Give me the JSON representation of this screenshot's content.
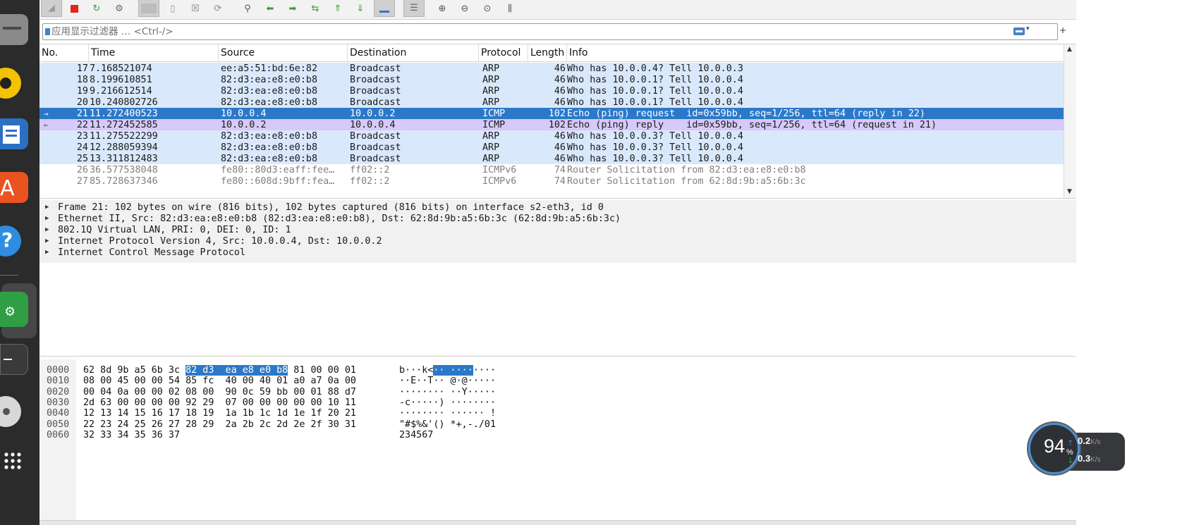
{
  "filter": {
    "placeholder": "应用显示过滤器 … <Ctrl-/>"
  },
  "packet_list": {
    "columns": [
      "No.",
      "Time",
      "Source",
      "Destination",
      "Protocol",
      "Length",
      "Info"
    ],
    "rows": [
      {
        "no": "17",
        "time": "7.168521074",
        "src": "ee:a5:51:bd:6e:82",
        "dst": "Broadcast",
        "proto": "ARP",
        "len": "46",
        "info": "Who has 10.0.0.4? Tell 10.0.0.3",
        "style": "arp"
      },
      {
        "no": "18",
        "time": "8.199610851",
        "src": "82:d3:ea:e8:e0:b8",
        "dst": "Broadcast",
        "proto": "ARP",
        "len": "46",
        "info": "Who has 10.0.0.1? Tell 10.0.0.4",
        "style": "arp"
      },
      {
        "no": "19",
        "time": "9.216612514",
        "src": "82:d3:ea:e8:e0:b8",
        "dst": "Broadcast",
        "proto": "ARP",
        "len": "46",
        "info": "Who has 10.0.0.1? Tell 10.0.0.4",
        "style": "arp"
      },
      {
        "no": "20",
        "time": "10.240802726",
        "src": "82:d3:ea:e8:e0:b8",
        "dst": "Broadcast",
        "proto": "ARP",
        "len": "46",
        "info": "Who has 10.0.0.1? Tell 10.0.0.4",
        "style": "arp"
      },
      {
        "no": "21",
        "time": "11.272400523",
        "src": "10.0.0.4",
        "dst": "10.0.0.2",
        "proto": "ICMP",
        "len": "102",
        "info": "Echo (ping) request  id=0x59bb, seq=1/256, ttl=64 (reply in 22)",
        "style": "selected"
      },
      {
        "no": "22",
        "time": "11.272452585",
        "src": "10.0.0.2",
        "dst": "10.0.0.4",
        "proto": "ICMP",
        "len": "102",
        "info": "Echo (ping) reply    id=0x59bb, seq=1/256, ttl=64 (request in 21)",
        "style": "icmp"
      },
      {
        "no": "23",
        "time": "11.275522299",
        "src": "82:d3:ea:e8:e0:b8",
        "dst": "Broadcast",
        "proto": "ARP",
        "len": "46",
        "info": "Who has 10.0.0.3? Tell 10.0.0.4",
        "style": "arp"
      },
      {
        "no": "24",
        "time": "12.288059394",
        "src": "82:d3:ea:e8:e0:b8",
        "dst": "Broadcast",
        "proto": "ARP",
        "len": "46",
        "info": "Who has 10.0.0.3? Tell 10.0.0.4",
        "style": "arp"
      },
      {
        "no": "25",
        "time": "13.311812483",
        "src": "82:d3:ea:e8:e0:b8",
        "dst": "Broadcast",
        "proto": "ARP",
        "len": "46",
        "info": "Who has 10.0.0.3? Tell 10.0.0.4",
        "style": "arp"
      },
      {
        "no": "26",
        "time": "36.577538048",
        "src": "fe80::80d3:eaff:fee…",
        "dst": "ff02::2",
        "proto": "ICMPv6",
        "len": "74",
        "info": "Router Solicitation from 82:d3:ea:e8:e0:b8",
        "style": "ipv6"
      },
      {
        "no": "27",
        "time": "85.728637346",
        "src": "fe80::608d:9bff:fea…",
        "dst": "ff02::2",
        "proto": "ICMPv6",
        "len": "74",
        "info": "Router Solicitation from 62:8d:9b:a5:6b:3c",
        "style": "ipv6"
      }
    ]
  },
  "details": [
    "Frame 21: 102 bytes on wire (816 bits), 102 bytes captured (816 bits) on interface s2-eth3, id 0",
    "Ethernet II, Src: 82:d3:ea:e8:e0:b8 (82:d3:ea:e8:e0:b8), Dst: 62:8d:9b:a5:6b:3c (62:8d:9b:a5:6b:3c)",
    "802.1Q Virtual LAN, PRI: 0, DEI: 0, ID: 1",
    "Internet Protocol Version 4, Src: 10.0.0.4, Dst: 10.0.0.2",
    "Internet Control Message Protocol"
  ],
  "bytes": [
    {
      "offset": "0000",
      "hex_pre": "62 8d 9b a5 6b 3c ",
      "hex_hl": "82 d3  ea e8 e0 b8",
      "hex_post": " 81 00 00 01",
      "ascii_pre": "b···k<",
      "ascii_hl": "·· ····",
      "ascii_post": "····"
    },
    {
      "offset": "0010",
      "hex_pre": "08 00 45 00 00 54 85 fc  40 00 40 01 a0 a7 0a 00",
      "hex_hl": "",
      "hex_post": "",
      "ascii_pre": "··E··T·· @·@·····",
      "ascii_hl": "",
      "ascii_post": ""
    },
    {
      "offset": "0020",
      "hex_pre": "00 04 0a 00 00 02 08 00  90 0c 59 bb 00 01 88 d7",
      "hex_hl": "",
      "hex_post": "",
      "ascii_pre": "········ ··Y·····",
      "ascii_hl": "",
      "ascii_post": ""
    },
    {
      "offset": "0030",
      "hex_pre": "2d 63 00 00 00 00 92 29  07 00 00 00 00 00 10 11",
      "hex_hl": "",
      "hex_post": "",
      "ascii_pre": "-c·····) ········",
      "ascii_hl": "",
      "ascii_post": ""
    },
    {
      "offset": "0040",
      "hex_pre": "12 13 14 15 16 17 18 19  1a 1b 1c 1d 1e 1f 20 21",
      "hex_hl": "",
      "hex_post": "",
      "ascii_pre": "········ ······ !",
      "ascii_hl": "",
      "ascii_post": ""
    },
    {
      "offset": "0050",
      "hex_pre": "22 23 24 25 26 27 28 29  2a 2b 2c 2d 2e 2f 30 31",
      "hex_hl": "",
      "hex_post": "",
      "ascii_pre": "\"#$%&'() *+,-./01",
      "ascii_hl": "",
      "ascii_post": ""
    },
    {
      "offset": "0060",
      "hex_pre": "32 33 34 35 36 37",
      "hex_hl": "",
      "hex_post": "",
      "ascii_pre": "234567",
      "ascii_hl": "",
      "ascii_post": ""
    }
  ],
  "speed_widget": {
    "percent": "94",
    "percent_sign": "%",
    "upload": "0.2",
    "download": "0.3",
    "unit": "K/s"
  },
  "colors": {
    "arp_row": "#d9e8fb",
    "selected_row": "#2c78c8",
    "icmp_row": "#d7c9f8",
    "ipv6_text": "#808080",
    "accent": "#4b8fd6"
  }
}
